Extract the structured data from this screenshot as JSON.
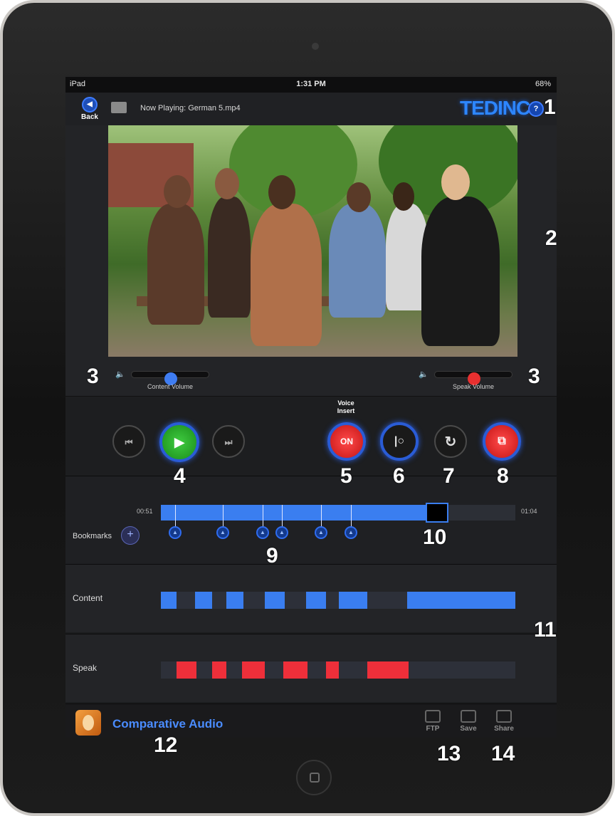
{
  "status": {
    "device": "iPad",
    "time": "1:31 PM",
    "battery": "68%"
  },
  "header": {
    "back_label": "Back",
    "now_playing": "Now Playing: German 5.mp4",
    "brand": "TEDINC",
    "help_symbol": "?"
  },
  "volume": {
    "content": {
      "label": "Content Volume",
      "level": 0.5,
      "knob_color": "#3f7df2"
    },
    "speak": {
      "label": "Speak Volume",
      "level": 0.5,
      "knob_color": "#e83030"
    }
  },
  "controls": {
    "voice_insert_label_1": "Voice",
    "voice_insert_label_2": "Insert",
    "on_label": "ON",
    "prev_symbol": "⏮",
    "play_symbol": "▶",
    "next_symbol": "⏭",
    "record_symbol": "|○",
    "loop_symbol": "↻",
    "compare_symbol": "⧉"
  },
  "timeline": {
    "start_time": "00:51",
    "end_time": "01:04",
    "progress": 0.75,
    "bookmarks_label": "Bookmarks",
    "add_symbol": "+",
    "bookmark_symbol": "▲",
    "bookmark_count": 6
  },
  "tracks": {
    "content_label": "Content",
    "speak_label": "Speak",
    "content_color": "#3a7ef0",
    "speak_color": "#ee2f3a"
  },
  "bottom": {
    "app_name": "Comparative Audio",
    "ftp_label": "FTP",
    "save_label": "Save",
    "share_label": "Share"
  },
  "annotations": [
    "1",
    "2",
    "3",
    "3",
    "4",
    "5",
    "6",
    "7",
    "8",
    "9",
    "10",
    "11",
    "12",
    "13",
    "14"
  ]
}
